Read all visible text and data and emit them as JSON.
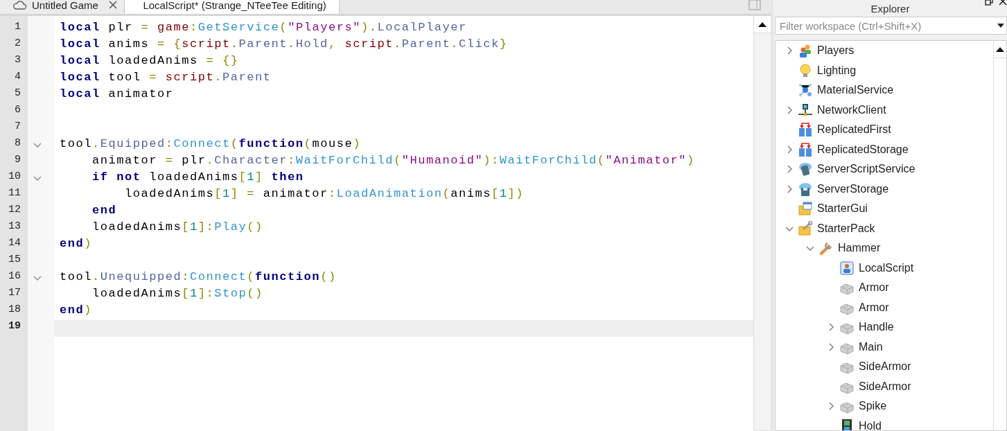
{
  "tabs": [
    {
      "label": "Untitled Game",
      "kind": "cloud",
      "selected": false
    },
    {
      "label": "LocalScript* (Strange_NTeeTee Editing)",
      "kind": "script",
      "selected": true
    }
  ],
  "editor": {
    "lines": [
      {
        "number": "1",
        "current": false,
        "tokens": [
          {
            "text": "local",
            "kind": "keyword"
          },
          {
            "text": " plr ",
            "kind": "plain"
          },
          {
            "text": "= ",
            "kind": "operator"
          },
          {
            "text": "game",
            "kind": "global"
          },
          {
            "text": ":",
            "kind": "operator"
          },
          {
            "text": "GetService",
            "kind": "method"
          },
          {
            "text": "(",
            "kind": "operator"
          },
          {
            "text": "\"Players\"",
            "kind": "string"
          },
          {
            "text": ").",
            "kind": "operator"
          },
          {
            "text": "LocalPlayer",
            "kind": "property"
          }
        ]
      },
      {
        "number": "2",
        "current": false,
        "tokens": [
          {
            "text": "local",
            "kind": "keyword"
          },
          {
            "text": " anims ",
            "kind": "plain"
          },
          {
            "text": "= {",
            "kind": "operator"
          },
          {
            "text": "script",
            "kind": "global"
          },
          {
            "text": ".",
            "kind": "operator"
          },
          {
            "text": "Parent",
            "kind": "property"
          },
          {
            "text": ".",
            "kind": "operator"
          },
          {
            "text": "Hold",
            "kind": "property"
          },
          {
            "text": ", ",
            "kind": "operator"
          },
          {
            "text": "script",
            "kind": "global"
          },
          {
            "text": ".",
            "kind": "operator"
          },
          {
            "text": "Parent",
            "kind": "property"
          },
          {
            "text": ".",
            "kind": "operator"
          },
          {
            "text": "Click",
            "kind": "property"
          },
          {
            "text": "}",
            "kind": "operator"
          }
        ]
      },
      {
        "number": "3",
        "current": false,
        "tokens": [
          {
            "text": "local",
            "kind": "keyword"
          },
          {
            "text": " loadedAnims ",
            "kind": "plain"
          },
          {
            "text": "= {}",
            "kind": "operator"
          }
        ]
      },
      {
        "number": "4",
        "current": false,
        "tokens": [
          {
            "text": "local",
            "kind": "keyword"
          },
          {
            "text": " tool ",
            "kind": "plain"
          },
          {
            "text": "= ",
            "kind": "operator"
          },
          {
            "text": "script",
            "kind": "global"
          },
          {
            "text": ".",
            "kind": "operator"
          },
          {
            "text": "Parent",
            "kind": "property"
          }
        ]
      },
      {
        "number": "5",
        "current": false,
        "tokens": [
          {
            "text": "local",
            "kind": "keyword"
          },
          {
            "text": " animator",
            "kind": "plain"
          }
        ]
      },
      {
        "number": "6",
        "current": false
      },
      {
        "number": "7",
        "current": false
      },
      {
        "number": "8",
        "foldable": true,
        "current": false,
        "tokens": [
          {
            "text": "tool",
            "kind": "plain"
          },
          {
            "text": ".",
            "kind": "operator"
          },
          {
            "text": "Equipped",
            "kind": "property"
          },
          {
            "text": ":",
            "kind": "operator"
          },
          {
            "text": "Connect",
            "kind": "method"
          },
          {
            "text": "(",
            "kind": "operator"
          },
          {
            "text": "function",
            "kind": "keyword"
          },
          {
            "text": "(",
            "kind": "operator"
          },
          {
            "text": "mouse",
            "kind": "plain"
          },
          {
            "text": ")",
            "kind": "operator"
          }
        ]
      },
      {
        "number": "9",
        "current": false,
        "tokens": [
          {
            "text": "    animator ",
            "kind": "plain"
          },
          {
            "text": "=",
            "kind": "operator"
          },
          {
            "text": " plr",
            "kind": "plain"
          },
          {
            "text": ".",
            "kind": "operator"
          },
          {
            "text": "Character",
            "kind": "property"
          },
          {
            "text": ":",
            "kind": "operator"
          },
          {
            "text": "WaitForChild",
            "kind": "method"
          },
          {
            "text": "(",
            "kind": "operator"
          },
          {
            "text": "\"Humanoid\"",
            "kind": "string"
          },
          {
            "text": "):",
            "kind": "operator"
          },
          {
            "text": "WaitForChild",
            "kind": "method"
          },
          {
            "text": "(",
            "kind": "operator"
          },
          {
            "text": "\"Animator\"",
            "kind": "string"
          },
          {
            "text": ")",
            "kind": "operator"
          }
        ]
      },
      {
        "number": "10",
        "foldable": true,
        "current": false,
        "tokens": [
          {
            "text": "    if not",
            "kind": "keyword"
          },
          {
            "text": " loadedAnims",
            "kind": "plain"
          },
          {
            "text": "[",
            "kind": "operator"
          },
          {
            "text": "1",
            "kind": "number"
          },
          {
            "text": "] ",
            "kind": "operator"
          },
          {
            "text": "then",
            "kind": "keyword"
          }
        ]
      },
      {
        "number": "11",
        "current": false,
        "tokens": [
          {
            "text": "        loadedAnims",
            "kind": "plain"
          },
          {
            "text": "[",
            "kind": "operator"
          },
          {
            "text": "1",
            "kind": "number"
          },
          {
            "text": "] = ",
            "kind": "operator"
          },
          {
            "text": "animator",
            "kind": "plain"
          },
          {
            "text": ":",
            "kind": "operator"
          },
          {
            "text": "LoadAnimation",
            "kind": "method"
          },
          {
            "text": "(",
            "kind": "operator"
          },
          {
            "text": "anims",
            "kind": "plain"
          },
          {
            "text": "[",
            "kind": "operator"
          },
          {
            "text": "1",
            "kind": "number"
          },
          {
            "text": "])",
            "kind": "operator"
          }
        ]
      },
      {
        "number": "12",
        "current": false,
        "tokens": [
          {
            "text": "    end",
            "kind": "keyword"
          }
        ]
      },
      {
        "number": "13",
        "current": false,
        "tokens": [
          {
            "text": "    loadedAnims",
            "kind": "plain"
          },
          {
            "text": "[",
            "kind": "operator"
          },
          {
            "text": "1",
            "kind": "number"
          },
          {
            "text": "]:",
            "kind": "operator"
          },
          {
            "text": "Play",
            "kind": "method"
          },
          {
            "text": "()",
            "kind": "operator"
          }
        ]
      },
      {
        "number": "14",
        "current": false,
        "tokens": [
          {
            "text": "end",
            "kind": "keyword"
          },
          {
            "text": ")",
            "kind": "operator"
          }
        ]
      },
      {
        "number": "15",
        "current": false
      },
      {
        "number": "16",
        "foldable": true,
        "current": false,
        "tokens": [
          {
            "text": "tool",
            "kind": "plain"
          },
          {
            "text": ".",
            "kind": "operator"
          },
          {
            "text": "Unequipped",
            "kind": "property"
          },
          {
            "text": ":",
            "kind": "operator"
          },
          {
            "text": "Connect",
            "kind": "method"
          },
          {
            "text": "(",
            "kind": "operator"
          },
          {
            "text": "function",
            "kind": "keyword"
          },
          {
            "text": "()",
            "kind": "operator"
          }
        ]
      },
      {
        "number": "17",
        "current": false,
        "tokens": [
          {
            "text": "    loadedAnims",
            "kind": "plain"
          },
          {
            "text": "[",
            "kind": "operator"
          },
          {
            "text": "1",
            "kind": "number"
          },
          {
            "text": "]:",
            "kind": "operator"
          },
          {
            "text": "Stop",
            "kind": "method"
          },
          {
            "text": "()",
            "kind": "operator"
          }
        ]
      },
      {
        "number": "18",
        "current": false,
        "tokens": [
          {
            "text": "end",
            "kind": "keyword"
          },
          {
            "text": ")",
            "kind": "operator"
          }
        ]
      },
      {
        "number": "19",
        "current": true
      }
    ]
  },
  "explorer": {
    "title": "Explorer",
    "filter": {
      "placeholder": "Filter workspace (Ctrl+Shift+X)"
    },
    "items": [
      {
        "label": "Players",
        "kind": "players",
        "expanded": false
      },
      {
        "label": "Lighting",
        "kind": "lighting"
      },
      {
        "label": "MaterialService",
        "kind": "material"
      },
      {
        "label": "NetworkClient",
        "kind": "network",
        "expanded": false
      },
      {
        "label": "ReplicatedFirst",
        "kind": "replicated"
      },
      {
        "label": "ReplicatedStorage",
        "kind": "replicated",
        "expanded": false
      },
      {
        "label": "ServerScriptService",
        "kind": "server-script",
        "expanded": false
      },
      {
        "label": "ServerStorage",
        "kind": "server-storage",
        "expanded": false
      },
      {
        "label": "StarterGui",
        "kind": "gui"
      },
      {
        "label": "StarterPack",
        "kind": "pack",
        "expanded": true,
        "children": [
          {
            "label": "Hammer",
            "kind": "tool",
            "expanded": true,
            "children": [
              {
                "label": "LocalScript",
                "kind": "script"
              },
              {
                "label": "Armor",
                "kind": "part"
              },
              {
                "label": "Armor",
                "kind": "part"
              },
              {
                "label": "Handle",
                "kind": "part",
                "expanded": false
              },
              {
                "label": "Main",
                "kind": "part",
                "expanded": false
              },
              {
                "label": "SideArmor",
                "kind": "part"
              },
              {
                "label": "SideArmor",
                "kind": "part"
              },
              {
                "label": "Spike",
                "kind": "part",
                "expanded": false
              },
              {
                "label": "Hold",
                "kind": "animation"
              }
            ]
          }
        ]
      }
    ]
  }
}
